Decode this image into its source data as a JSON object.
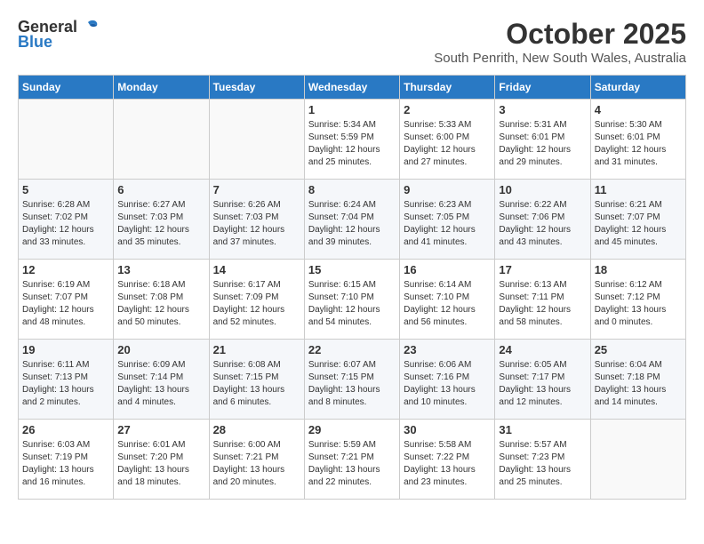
{
  "header": {
    "logo_general": "General",
    "logo_blue": "Blue",
    "month": "October 2025",
    "location": "South Penrith, New South Wales, Australia"
  },
  "days_of_week": [
    "Sunday",
    "Monday",
    "Tuesday",
    "Wednesday",
    "Thursday",
    "Friday",
    "Saturday"
  ],
  "weeks": [
    [
      {
        "day": "",
        "info": ""
      },
      {
        "day": "",
        "info": ""
      },
      {
        "day": "",
        "info": ""
      },
      {
        "day": "1",
        "info": "Sunrise: 5:34 AM\nSunset: 5:59 PM\nDaylight: 12 hours\nand 25 minutes."
      },
      {
        "day": "2",
        "info": "Sunrise: 5:33 AM\nSunset: 6:00 PM\nDaylight: 12 hours\nand 27 minutes."
      },
      {
        "day": "3",
        "info": "Sunrise: 5:31 AM\nSunset: 6:01 PM\nDaylight: 12 hours\nand 29 minutes."
      },
      {
        "day": "4",
        "info": "Sunrise: 5:30 AM\nSunset: 6:01 PM\nDaylight: 12 hours\nand 31 minutes."
      }
    ],
    [
      {
        "day": "5",
        "info": "Sunrise: 6:28 AM\nSunset: 7:02 PM\nDaylight: 12 hours\nand 33 minutes."
      },
      {
        "day": "6",
        "info": "Sunrise: 6:27 AM\nSunset: 7:03 PM\nDaylight: 12 hours\nand 35 minutes."
      },
      {
        "day": "7",
        "info": "Sunrise: 6:26 AM\nSunset: 7:03 PM\nDaylight: 12 hours\nand 37 minutes."
      },
      {
        "day": "8",
        "info": "Sunrise: 6:24 AM\nSunset: 7:04 PM\nDaylight: 12 hours\nand 39 minutes."
      },
      {
        "day": "9",
        "info": "Sunrise: 6:23 AM\nSunset: 7:05 PM\nDaylight: 12 hours\nand 41 minutes."
      },
      {
        "day": "10",
        "info": "Sunrise: 6:22 AM\nSunset: 7:06 PM\nDaylight: 12 hours\nand 43 minutes."
      },
      {
        "day": "11",
        "info": "Sunrise: 6:21 AM\nSunset: 7:07 PM\nDaylight: 12 hours\nand 45 minutes."
      }
    ],
    [
      {
        "day": "12",
        "info": "Sunrise: 6:19 AM\nSunset: 7:07 PM\nDaylight: 12 hours\nand 48 minutes."
      },
      {
        "day": "13",
        "info": "Sunrise: 6:18 AM\nSunset: 7:08 PM\nDaylight: 12 hours\nand 50 minutes."
      },
      {
        "day": "14",
        "info": "Sunrise: 6:17 AM\nSunset: 7:09 PM\nDaylight: 12 hours\nand 52 minutes."
      },
      {
        "day": "15",
        "info": "Sunrise: 6:15 AM\nSunset: 7:10 PM\nDaylight: 12 hours\nand 54 minutes."
      },
      {
        "day": "16",
        "info": "Sunrise: 6:14 AM\nSunset: 7:10 PM\nDaylight: 12 hours\nand 56 minutes."
      },
      {
        "day": "17",
        "info": "Sunrise: 6:13 AM\nSunset: 7:11 PM\nDaylight: 12 hours\nand 58 minutes."
      },
      {
        "day": "18",
        "info": "Sunrise: 6:12 AM\nSunset: 7:12 PM\nDaylight: 13 hours\nand 0 minutes."
      }
    ],
    [
      {
        "day": "19",
        "info": "Sunrise: 6:11 AM\nSunset: 7:13 PM\nDaylight: 13 hours\nand 2 minutes."
      },
      {
        "day": "20",
        "info": "Sunrise: 6:09 AM\nSunset: 7:14 PM\nDaylight: 13 hours\nand 4 minutes."
      },
      {
        "day": "21",
        "info": "Sunrise: 6:08 AM\nSunset: 7:15 PM\nDaylight: 13 hours\nand 6 minutes."
      },
      {
        "day": "22",
        "info": "Sunrise: 6:07 AM\nSunset: 7:15 PM\nDaylight: 13 hours\nand 8 minutes."
      },
      {
        "day": "23",
        "info": "Sunrise: 6:06 AM\nSunset: 7:16 PM\nDaylight: 13 hours\nand 10 minutes."
      },
      {
        "day": "24",
        "info": "Sunrise: 6:05 AM\nSunset: 7:17 PM\nDaylight: 13 hours\nand 12 minutes."
      },
      {
        "day": "25",
        "info": "Sunrise: 6:04 AM\nSunset: 7:18 PM\nDaylight: 13 hours\nand 14 minutes."
      }
    ],
    [
      {
        "day": "26",
        "info": "Sunrise: 6:03 AM\nSunset: 7:19 PM\nDaylight: 13 hours\nand 16 minutes."
      },
      {
        "day": "27",
        "info": "Sunrise: 6:01 AM\nSunset: 7:20 PM\nDaylight: 13 hours\nand 18 minutes."
      },
      {
        "day": "28",
        "info": "Sunrise: 6:00 AM\nSunset: 7:21 PM\nDaylight: 13 hours\nand 20 minutes."
      },
      {
        "day": "29",
        "info": "Sunrise: 5:59 AM\nSunset: 7:21 PM\nDaylight: 13 hours\nand 22 minutes."
      },
      {
        "day": "30",
        "info": "Sunrise: 5:58 AM\nSunset: 7:22 PM\nDaylight: 13 hours\nand 23 minutes."
      },
      {
        "day": "31",
        "info": "Sunrise: 5:57 AM\nSunset: 7:23 PM\nDaylight: 13 hours\nand 25 minutes."
      },
      {
        "day": "",
        "info": ""
      }
    ]
  ]
}
